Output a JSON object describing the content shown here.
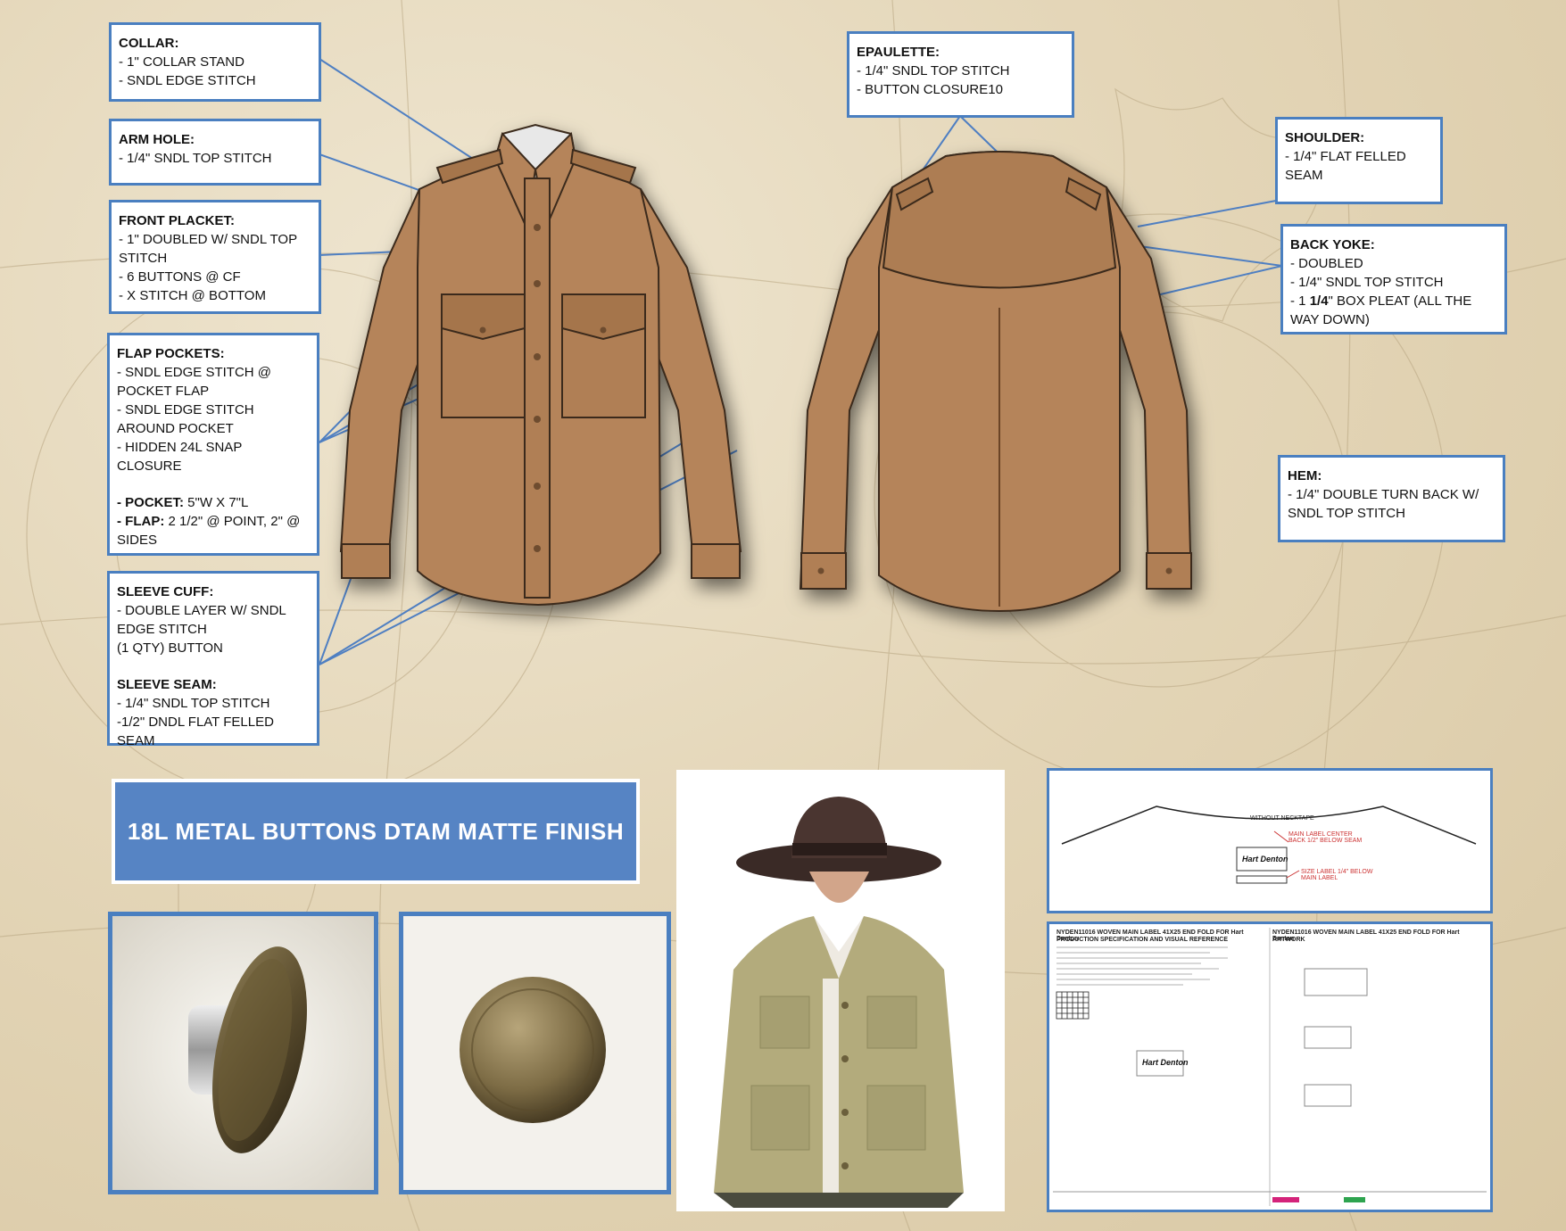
{
  "callouts": {
    "collar": {
      "title": "COLLAR:",
      "lines": [
        "- 1\" COLLAR STAND",
        "- SNDL EDGE STITCH"
      ]
    },
    "arm_hole": {
      "title": "ARM HOLE:",
      "lines": [
        "- 1/4\" SNDL TOP STITCH"
      ]
    },
    "front_placket": {
      "title": "FRONT PLACKET:",
      "lines": [
        "- 1\" DOUBLED W/ SNDL TOP STITCH",
        "- 6 BUTTONS @ CF",
        "- X STITCH @ BOTTOM"
      ]
    },
    "flap_pockets": {
      "title": "FLAP POCKETS:",
      "lines": [
        "- SNDL EDGE STITCH @ POCKET FLAP",
        "- SNDL EDGE STITCH AROUND POCKET",
        "- HIDDEN 24L SNAP CLOSURE"
      ],
      "pocket_label": "- POCKET:",
      "pocket_value": " 5\"W X 7\"L",
      "flap_label": "- FLAP:",
      "flap_value": " 2 1/2\" @ POINT, 2\" @ SIDES"
    },
    "sleeve_cuff": {
      "title": "SLEEVE CUFF:",
      "lines": [
        "- DOUBLE LAYER W/ SNDL EDGE STITCH",
        "(1 QTY) BUTTON"
      ]
    },
    "sleeve_seam": {
      "title": "SLEEVE SEAM:",
      "lines": [
        "- 1/4\" SNDL TOP STITCH",
        "-1/2\" DNDL FLAT FELLED SEAM"
      ]
    },
    "epaulette": {
      "title": "EPAULETTE:",
      "lines": [
        "- 1/4\" SNDL TOP STITCH",
        "- BUTTON CLOSURE10"
      ]
    },
    "shoulder": {
      "title": "SHOULDER:",
      "lines": [
        "- 1/4\" FLAT FELLED SEAM"
      ]
    },
    "back_yoke": {
      "title": "BACK YOKE:",
      "lines": [
        "- DOUBLED",
        "- 1/4\" SNDL TOP STITCH"
      ],
      "pleat_pre": "- 1 ",
      "pleat_bold": "1/4",
      "pleat_post": "\" BOX PLEAT (ALL THE WAY DOWN)"
    },
    "hem": {
      "title": "HEM:",
      "lines": [
        "- 1/4\" DOUBLE TURN BACK W/ SNDL TOP STITCH"
      ]
    }
  },
  "banner": {
    "text": "18L METAL BUTTONS DTAM MATTE FINISH"
  },
  "label_doc_top": {
    "heading": "WITHOUT NECKTAPE",
    "note1": "MAIN LABEL CENTER BACK 1/2\" BELOW SEAM",
    "note2": "SIZE LABEL 1/4\" BELOW MAIN LABEL",
    "brand": "Hart Denton"
  },
  "label_doc_bottom": {
    "left_title": "NYDEN11016 WOVEN MAIN LABEL 41X25 END FOLD FOR Hart Denton",
    "left_sub": "PRODUCTION SPECIFICATION AND VISUAL REFERENCE",
    "right_title": "NYDEN11016 WOVEN MAIN LABEL 41X25 END FOLD FOR Hart Denton",
    "right_sub": "ARTWORK",
    "brand": "Hart Denton"
  },
  "colors": {
    "accent": "#4a7fc0",
    "banner": "#5684c4",
    "shirt": "#b5845a",
    "shirt_dark": "#8f6440",
    "line": "#4f7fc2"
  }
}
